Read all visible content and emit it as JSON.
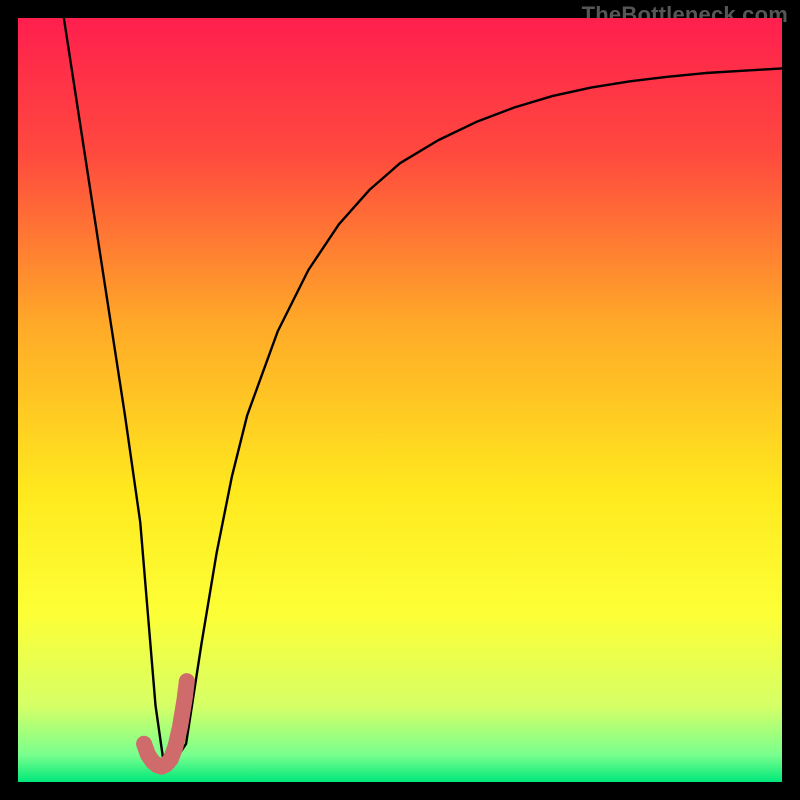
{
  "watermark": "TheBottleneck.com",
  "colors": {
    "curve": "#000000",
    "highlight": "#cf6b6b",
    "frame": "#000000"
  },
  "chart_data": {
    "type": "line",
    "title": "",
    "xlabel": "",
    "ylabel": "",
    "xlim": [
      0,
      100
    ],
    "ylim": [
      0,
      100
    ],
    "grid": false,
    "legend": false,
    "background_gradient_stops": [
      {
        "pos": 0.0,
        "color": "#ff1f4e"
      },
      {
        "pos": 0.18,
        "color": "#ff4a3e"
      },
      {
        "pos": 0.4,
        "color": "#ffa928"
      },
      {
        "pos": 0.62,
        "color": "#ffe91e"
      },
      {
        "pos": 0.78,
        "color": "#fdff36"
      },
      {
        "pos": 0.9,
        "color": "#d6ff66"
      },
      {
        "pos": 0.965,
        "color": "#78ff8e"
      },
      {
        "pos": 1.0,
        "color": "#00e87a"
      }
    ],
    "series": [
      {
        "name": "bottleneck-curve",
        "x": [
          6,
          8,
          10,
          12,
          14,
          16,
          17,
          18,
          19,
          20,
          22,
          24,
          26,
          28,
          30,
          34,
          38,
          42,
          46,
          50,
          55,
          60,
          65,
          70,
          75,
          80,
          85,
          90,
          95,
          100
        ],
        "y": [
          100,
          87,
          74,
          61,
          48,
          34,
          22,
          10,
          3,
          2,
          5,
          18,
          30,
          40,
          48,
          59,
          67,
          73,
          77.5,
          81,
          84,
          86.4,
          88.3,
          89.8,
          90.9,
          91.7,
          92.3,
          92.8,
          93.1,
          93.4
        ]
      }
    ],
    "highlight_segment": {
      "name": "optimal-range-marker",
      "x": [
        16.5,
        17.0,
        17.6,
        18.2,
        18.8,
        19.4,
        20.0,
        20.6,
        21.2,
        21.8,
        22.1
      ],
      "y": [
        5.0,
        3.6,
        2.7,
        2.2,
        2.0,
        2.3,
        3.0,
        4.6,
        7.2,
        10.8,
        13.2
      ]
    }
  }
}
